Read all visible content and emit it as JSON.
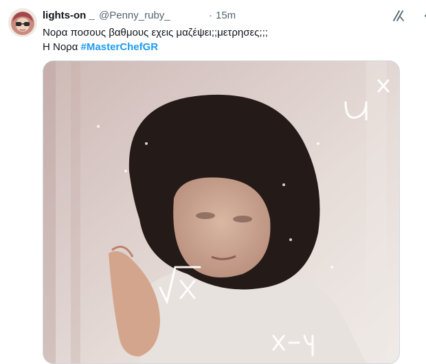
{
  "tweet": {
    "author_name": "lights-on _",
    "handle": "@Penny_ruby_",
    "separator": "·",
    "time": "15m",
    "text_line1": "Νορα ποσους βαθμους εχεις μαζέψει;;μετρησες;;;",
    "text_line2_prefix": "Η Νορα ",
    "hashtag": "#MasterChefGR"
  },
  "icons": {
    "avatar": "avatar-image",
    "grok": "grok-icon",
    "more": "more-options-icon"
  },
  "media": {
    "kind": "gif-image",
    "overlay_math": [
      "u",
      "x",
      "√x",
      "x-y",
      "+"
    ]
  },
  "colors": {
    "hashtag": "#1d9bf0",
    "secondary_text": "#536471",
    "primary_text": "#0f1419"
  }
}
